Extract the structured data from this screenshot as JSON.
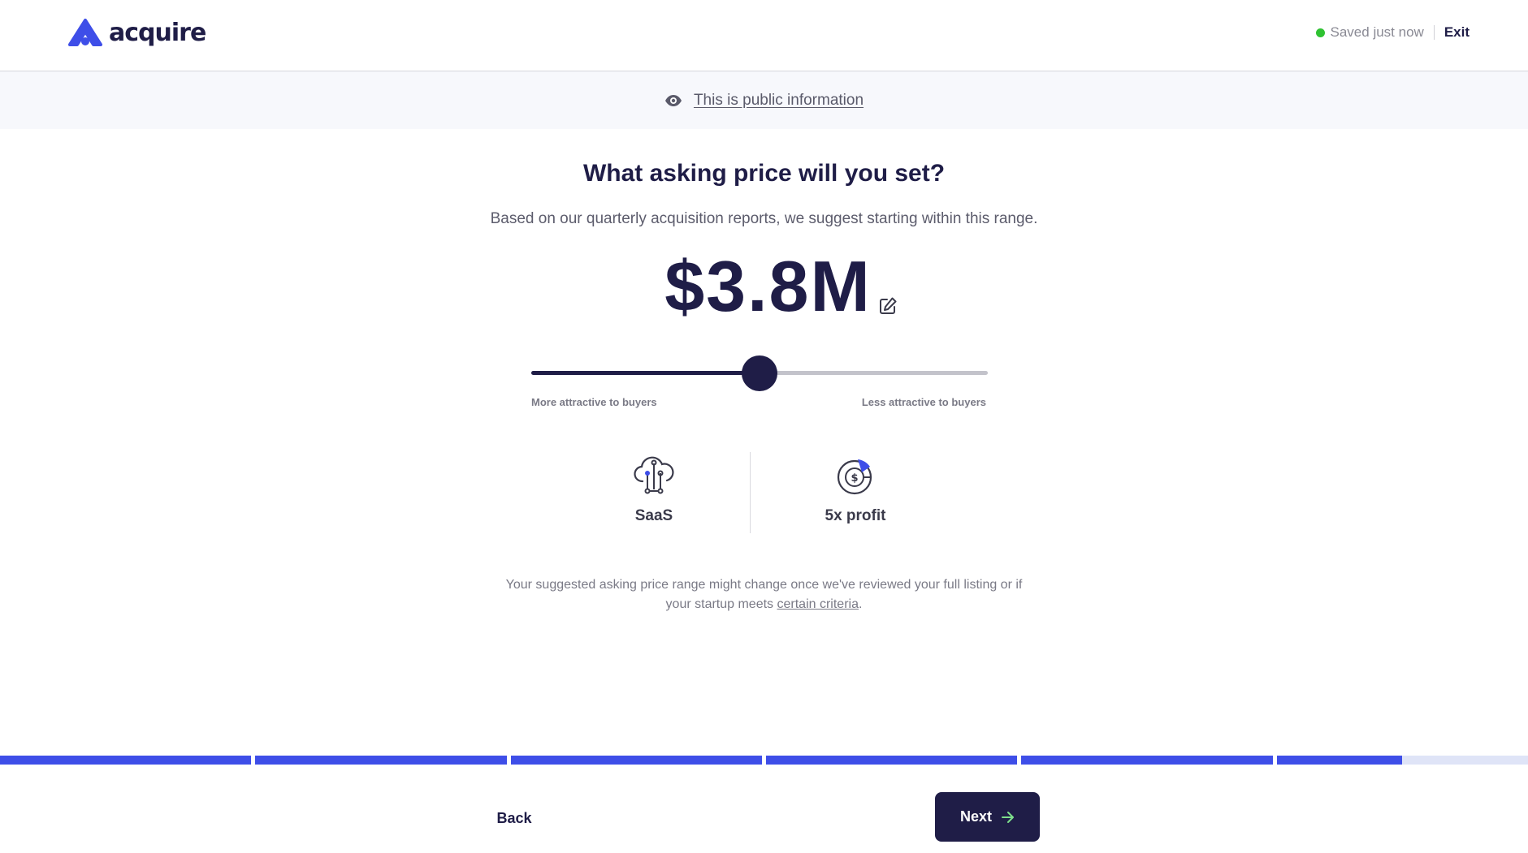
{
  "header": {
    "brand": "acquire",
    "save_status": "Saved just now",
    "exit_label": "Exit",
    "status_color": "#2fc232"
  },
  "banner": {
    "icon": "eye-icon",
    "link_text": "This is public information"
  },
  "main": {
    "title": "What asking price will you set?",
    "subtitle": "Based on our quarterly acquisition reports, we suggest starting within this range.",
    "price": "$3.8M",
    "edit_icon": "edit-icon",
    "slider": {
      "value_fraction": 0.5,
      "left_label": "More attractive to buyers",
      "right_label": "Less attractive to buyers"
    },
    "stats": [
      {
        "icon": "cloud-network-icon",
        "label": "SaaS"
      },
      {
        "icon": "dollar-chart-icon",
        "label": "5x profit"
      }
    ],
    "footnote_before": "Your suggested asking price range might change once we've reviewed your full listing or if your startup meets ",
    "footnote_link": "certain criteria",
    "footnote_after": "."
  },
  "progress": {
    "segments": [
      1,
      1,
      1,
      1,
      1,
      0.5
    ],
    "color": "#3e4ee8",
    "track_color": "#dfe4f7"
  },
  "footer": {
    "back_label": "Back",
    "next_label": "Next",
    "next_icon": "arrow-right-icon"
  }
}
